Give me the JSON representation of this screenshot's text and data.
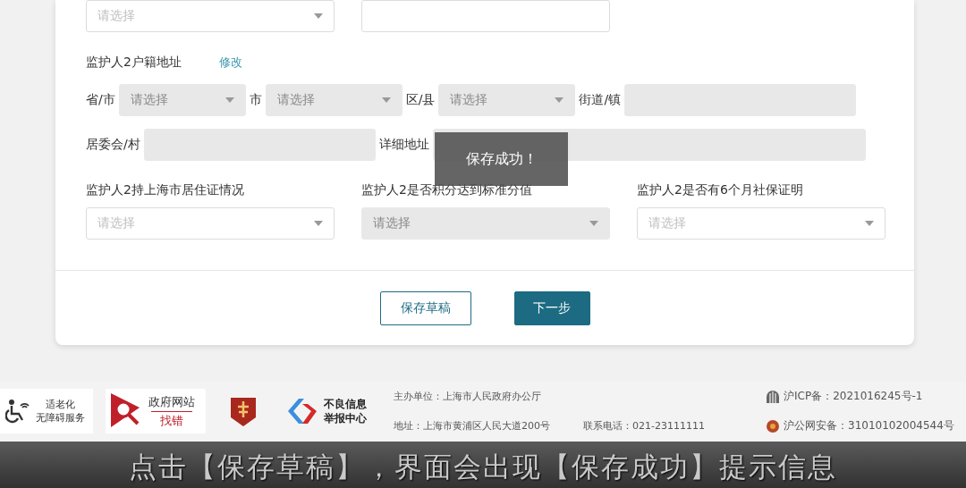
{
  "form": {
    "top_row": [
      {
        "kind": "select",
        "placeholder": "请选择",
        "disabled": false
      },
      {
        "kind": "input",
        "disabled": false
      }
    ],
    "address": {
      "title": "监护人2户籍地址",
      "edit_link": "修改",
      "rows": [
        [
          {
            "label": "省/市",
            "kind": "select",
            "placeholder": "请选择",
            "disabled": true
          },
          {
            "label": "市",
            "kind": "select",
            "placeholder": "请选择",
            "disabled": true
          },
          {
            "label": "区/县",
            "kind": "select",
            "placeholder": "请选择",
            "disabled": true
          },
          {
            "label": "街道/镇",
            "kind": "input",
            "disabled": true
          }
        ],
        [
          {
            "label": "居委会/村",
            "kind": "input",
            "disabled": true
          },
          {
            "label": "详细地址",
            "kind": "input",
            "disabled": true
          }
        ]
      ]
    },
    "questions": [
      {
        "label": "监护人2持上海市居住证情况",
        "placeholder": "请选择",
        "disabled": false
      },
      {
        "label": "监护人2是否积分达到标准分值",
        "placeholder": "请选择",
        "disabled": true
      },
      {
        "label": "监护人2是否有6个月社保证明",
        "placeholder": "请选择",
        "disabled": false
      }
    ],
    "buttons": [
      {
        "label": "保存草稿",
        "kind": "outline"
      },
      {
        "label": "下一步",
        "kind": "primary"
      }
    ]
  },
  "toast": "保存成功！",
  "footer": {
    "badges": [
      {
        "kind": "accessibility",
        "lines": [
          "适老化",
          "无障碍服务"
        ]
      },
      {
        "kind": "error_report",
        "lines": [
          "政府网站",
          "找错"
        ]
      },
      {
        "kind": "emblem"
      },
      {
        "kind": "report_center",
        "lines": [
          "不良信息",
          "举报中心"
        ]
      }
    ],
    "host": "主办单位：上海市人民政府办公厅",
    "address": "地址：上海市黄浦区人民大道200号",
    "phone": "联系电话：021-23111111",
    "icp": "沪ICP备：2021016245号-1",
    "police": "沪公网安备：31010102004544号"
  },
  "subtitle": "点击【保存草稿】，界面会出现【保存成功】提示信息"
}
